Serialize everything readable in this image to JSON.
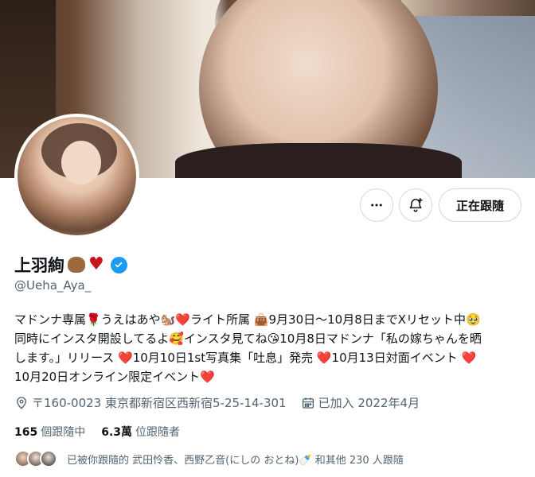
{
  "profile": {
    "display_name": "上羽絢",
    "name_emojis": [
      "squirrel-emoji",
      "red-heart-emoji"
    ],
    "handle": "@Ueha_Aya_",
    "bio_lines": [
      "マドンナ専属🌹うえはあや🐿️❤️ライト所属 👜9月30日～10月8日までXリセット中🥹",
      "同時にインスタ開設してるよ🥰インスタ見てね😘10月8日マドンナ「私の嫁ちゃんを晒",
      "します。」リリース ❤️10月10日1st写真集「吐息」発売 ❤️10月13日対面イベント ❤️",
      "10月20日オンライン限定イベント❤️"
    ],
    "location": "〒160-0023 東京都新宿区西新宿5-25-14-301",
    "joined": "已加入 2022年4月",
    "following_count": "165",
    "following_label": "個跟隨中",
    "followers_count": "6.3萬",
    "followers_label": "位跟隨者",
    "followed_by_text": "已被你跟隨的 武田怜香、西野乙音(にしの おとね)🍼 和其他 230 人跟隨"
  },
  "actions": {
    "more_icon": "more-horizontal-icon",
    "notify_icon": "bell-plus-icon",
    "follow_label": "正在跟隨"
  },
  "colors": {
    "verified": "#1d9bf0",
    "secondary_text": "#536471",
    "primary_text": "#0f1419",
    "border": "#cfd9de"
  }
}
